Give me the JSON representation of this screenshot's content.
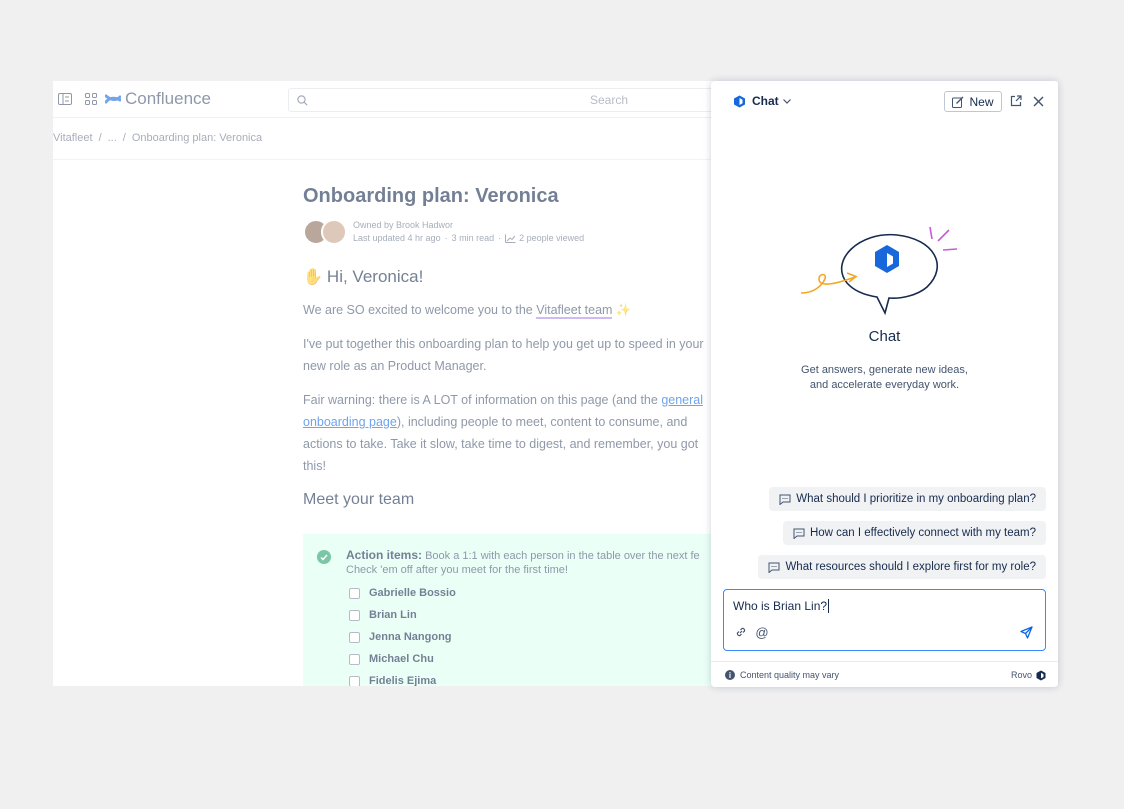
{
  "app": {
    "name": "Confluence"
  },
  "search": {
    "placeholder": "Search"
  },
  "breadcrumb": {
    "space": "Vitafleet",
    "sep1": "/",
    "ellipsis": "...",
    "sep2": "/",
    "page": "Onboarding plan: Veronica"
  },
  "page": {
    "title": "Onboarding plan: Veronica",
    "owner": "Owned by Brook Hadwor",
    "meta_updated": "Last updated 4 hr ago",
    "meta_read": "3 min read",
    "meta_views": "2 people viewed",
    "greeting": "Hi, Veronica!",
    "p1_pre": "We are SO excited to welcome you to the",
    "p1_link": "Vitafleet team",
    "p2": "I've put together this onboarding plan to help you get up to speed in your new role as an Product Manager.",
    "p3_pre": "Fair warning: there is A LOT of information on this page (and the",
    "p3_link": "general onboarding page",
    "p3_post": "), including people to meet, content to consume, and actions to take. Take it slow, take time to digest, and remember, you got this!",
    "section": "Meet your team",
    "action_label": "Action items:",
    "action_text": "Book a 1:1 with each person in the table over the next fe",
    "action_text2": "Check 'em off after you meet for the first time!",
    "tasks": [
      "Gabrielle Bossio",
      "Brian Lin",
      "Jenna Nangong",
      "Michael Chu",
      "Fidelis Ejima"
    ]
  },
  "chat": {
    "menu_label": "Chat",
    "new_label": "New",
    "title": "Chat",
    "subtitle_1": "Get answers, generate new ideas,",
    "subtitle_2": "and accelerate everyday work.",
    "suggestions": [
      "What should I prioritize in my onboarding plan?",
      "How can I effectively connect with my team?",
      "What resources should I explore first for my role?"
    ],
    "input_value": "Who is Brian Lin?",
    "footer_note": "Content quality may vary",
    "brand": "Rovo"
  },
  "colors": {
    "accent": "#0c66e4",
    "action_bg": "#dcfff1",
    "composer_border": "#388bff",
    "check": "#22a06b"
  },
  "icons": [
    "sidebar-toggle-icon",
    "app-switcher-icon",
    "confluence-logo-icon",
    "search-icon",
    "avatar",
    "trend-icon",
    "wave-emoji-icon",
    "party-emoji-icon",
    "check-circle-icon",
    "rovo-logo-icon",
    "chevron-down-icon",
    "edit-icon",
    "open-external-icon",
    "close-icon",
    "chat-bubble-icon",
    "link-icon",
    "mention-icon",
    "send-icon",
    "info-icon"
  ]
}
